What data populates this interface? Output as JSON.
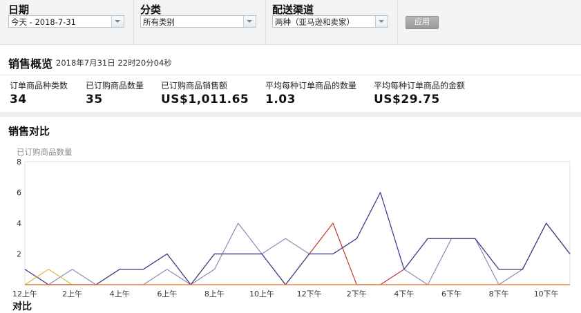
{
  "filters": {
    "date": {
      "label": "日期",
      "value": "今天 - 2018-7-31"
    },
    "category": {
      "label": "分类",
      "value": "所有类别"
    },
    "channel": {
      "label": "配送渠道",
      "value": "两种（亚马逊和卖家）"
    },
    "apply_label": "应用"
  },
  "overview": {
    "title": "销售概览",
    "timestamp": "2018年7月31日 22时20分04秒",
    "metrics": [
      {
        "label": "订单商品种类数",
        "value": "34"
      },
      {
        "label": "已订购商品数量",
        "value": "35"
      },
      {
        "label": "已订购商品销售额",
        "value": "US$1,011.65"
      },
      {
        "label": "平均每种订单商品的数量",
        "value": "1.03"
      },
      {
        "label": "平均每种订单商品的金额",
        "value": "US$29.75"
      }
    ]
  },
  "comparison": {
    "title": "销售对比",
    "bottom_label_partial": "对比"
  },
  "chart_data": {
    "type": "line",
    "ylabel": "已订购商品数量",
    "ylim": [
      0,
      8
    ],
    "y_ticks": [
      "8",
      "6",
      "4",
      "2"
    ],
    "grid": false,
    "x_tick_labels": [
      "12上午",
      "2上午",
      "4上午",
      "6上午",
      "8上午",
      "10上午",
      "12下午",
      "2下午",
      "4下午",
      "6下午",
      "8下午",
      "10下午"
    ],
    "x": [
      0,
      1,
      2,
      3,
      4,
      5,
      6,
      7,
      8,
      9,
      10,
      11,
      12,
      13,
      14,
      15,
      16,
      17,
      18,
      19,
      20,
      21,
      22,
      23
    ],
    "series": [
      {
        "color": "#8a8ab8",
        "values": [
          1,
          0,
          1,
          0,
          0,
          0,
          1,
          0,
          1,
          4,
          2,
          3,
          2,
          2,
          3,
          6,
          1,
          0,
          3,
          3,
          0,
          1,
          4,
          2
        ]
      },
      {
        "color": "#c0392b",
        "values": [
          0,
          0,
          0,
          0,
          1,
          1,
          2,
          0,
          2,
          2,
          2,
          0,
          2,
          4,
          0,
          0,
          1,
          3,
          3,
          3,
          1,
          1,
          4,
          2
        ]
      },
      {
        "color": "#3d3d8f",
        "values": [
          1,
          0,
          0,
          0,
          1,
          1,
          2,
          0,
          2,
          2,
          2,
          0,
          2,
          2,
          3,
          6,
          1,
          3,
          3,
          3,
          1,
          1,
          4,
          2
        ]
      },
      {
        "color": "#e0b43c",
        "values": [
          0,
          1,
          0,
          0,
          0,
          0,
          0,
          0,
          0,
          0,
          0,
          0,
          0,
          0,
          0,
          0,
          0,
          0,
          0,
          0,
          0,
          0,
          0,
          0
        ]
      },
      {
        "color": "#e07b3c",
        "values": [
          0,
          0,
          0,
          0,
          0,
          0,
          0,
          0,
          0,
          0,
          0,
          0,
          0,
          0,
          0,
          0,
          0,
          0,
          0,
          0,
          0,
          0,
          0,
          0
        ]
      }
    ],
    "colors": {
      "accent": "#3d3d8f",
      "secondary": "#c0392b"
    }
  }
}
